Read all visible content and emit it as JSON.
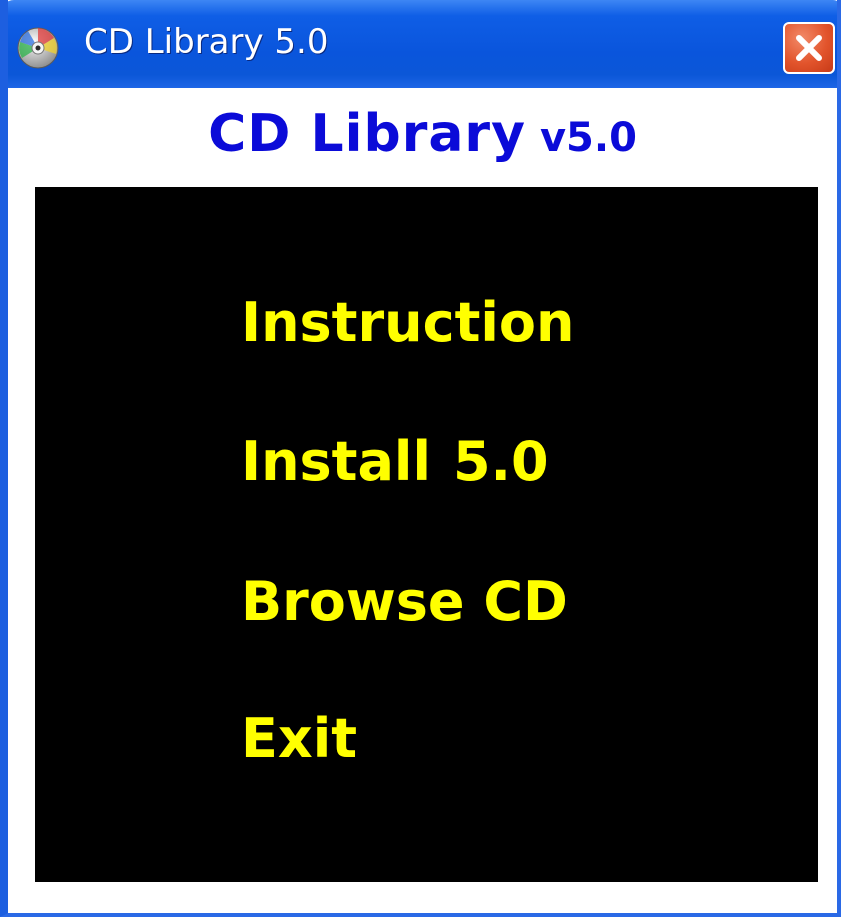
{
  "window": {
    "title": "CD Library 5.0",
    "icon": "cd-disc-icon",
    "close_icon": "close-icon"
  },
  "heading": {
    "name": "CD Library",
    "version": "v5.0",
    "color": "#0b0bd8"
  },
  "menu": {
    "instruction": "Instruction",
    "install_word": "Install",
    "install_version": "5.0",
    "browse": "Browse CD",
    "exit": "Exit",
    "text_color": "#ffff00",
    "background": "#000000"
  },
  "colors": {
    "titlebar": "#0a55dc",
    "close_button": "#e2542c"
  }
}
